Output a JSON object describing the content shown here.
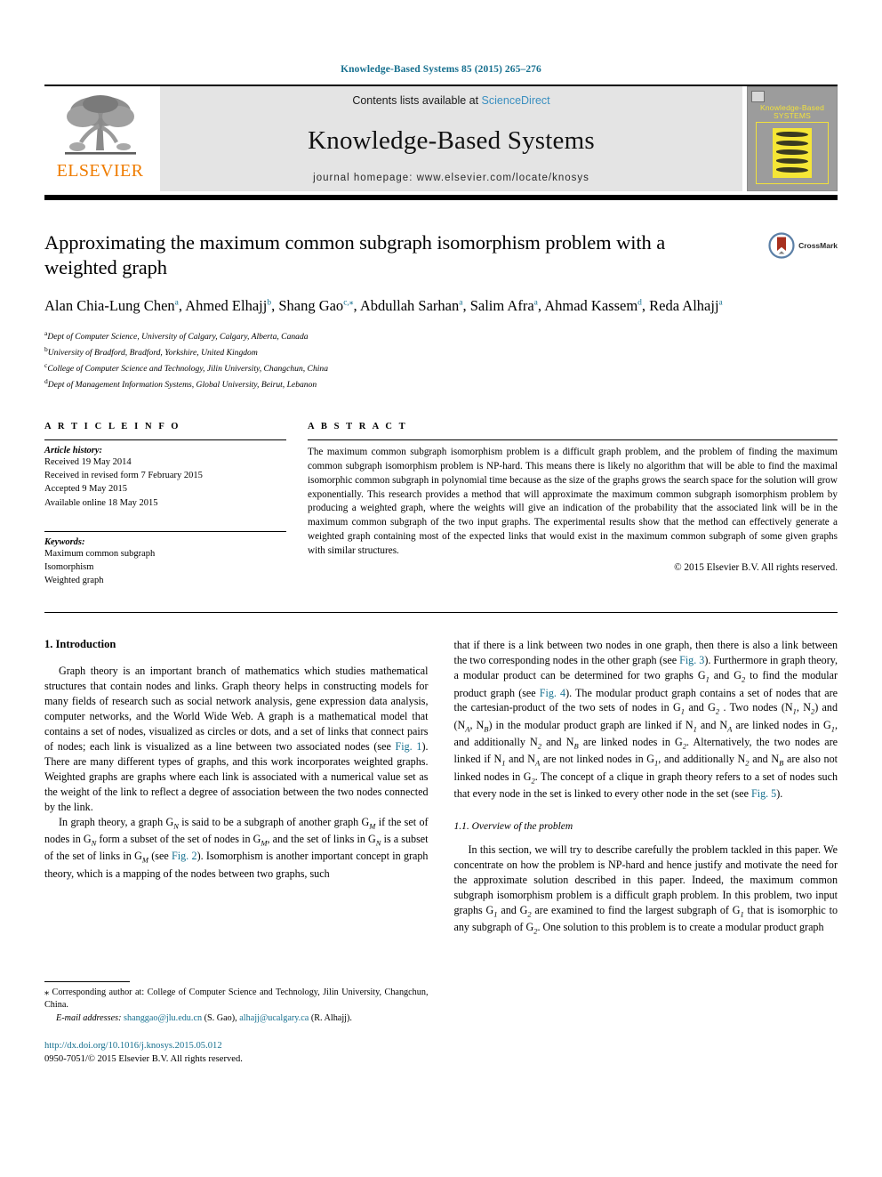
{
  "running_head": "Knowledge-Based Systems 85 (2015) 265–276",
  "masthead": {
    "publisher_name": "ELSEVIER",
    "contents_prefix": "Contents lists available at ",
    "contents_link": "ScienceDirect",
    "journal_title": "Knowledge-Based Systems",
    "homepage_line": "journal homepage: www.elsevier.com/locate/knosys",
    "cover": {
      "line1": "Knowledge-Based",
      "line2": "SYSTEMS"
    },
    "colors": {
      "elsevier_orange": "#ef7c00",
      "link_blue": "#17708f",
      "sciencedirect_blue": "#3a8fc0",
      "band_gray": "#e4e4e4",
      "cover_gray": "#9c9c9c",
      "cover_yellow": "#f2e23a"
    }
  },
  "title": "Approximating the maximum common subgraph isomorphism problem with a weighted graph",
  "crossmark_label": "CrossMark",
  "authors": [
    {
      "name": "Alan Chia-Lung Chen",
      "marks": "a",
      "sep": ", "
    },
    {
      "name": "Ahmed Elhajj",
      "marks": "b",
      "sep": ", "
    },
    {
      "name": "Shang Gao",
      "marks": "c,⁎",
      "sep": ", "
    },
    {
      "name": "Abdullah Sarhan",
      "marks": "a",
      "sep": ", "
    },
    {
      "name": "Salim Afra",
      "marks": "a",
      "sep": ", "
    },
    {
      "name": "Ahmad Kassem",
      "marks": "d",
      "sep": ", "
    },
    {
      "name": "Reda Alhajj",
      "marks": "a",
      "sep": ""
    }
  ],
  "affiliations": [
    {
      "mark": "a",
      "text": "Dept of Computer Science, University of Calgary, Calgary, Alberta, Canada"
    },
    {
      "mark": "b",
      "text": "University of Bradford, Bradford, Yorkshire, United Kingdom"
    },
    {
      "mark": "c",
      "text": "College of Computer Science and Technology, Jilin University, Changchun, China"
    },
    {
      "mark": "d",
      "text": "Dept of Management Information Systems, Global University, Beirut, Lebanon"
    }
  ],
  "article_info": {
    "heading": "A R T I C L E  I N F O",
    "history_label": "Article history:",
    "history": [
      "Received 19 May 2014",
      "Received in revised form 7 February 2015",
      "Accepted 9 May 2015",
      "Available online 18 May 2015"
    ],
    "keywords_label": "Keywords:",
    "keywords": [
      "Maximum common subgraph",
      "Isomorphism",
      "Weighted graph"
    ]
  },
  "abstract": {
    "heading": "A B S T R A C T",
    "text": "The maximum common subgraph isomorphism problem is a difficult graph problem, and the problem of finding the maximum common subgraph isomorphism problem is NP-hard. This means there is likely no algorithm that will be able to find the maximal isomorphic common subgraph in polynomial time because as the size of the graphs grows the search space for the solution will grow exponentially. This research provides a method that will approximate the maximum common subgraph isomorphism problem by producing a weighted graph, where the weights will give an indication of the probability that the associated link will be in the maximum common subgraph of the two input graphs. The experimental results show that the method can effectively generate a weighted graph containing most of the expected links that would exist in the maximum common subgraph of some given graphs with similar structures.",
    "copyright": "© 2015 Elsevier B.V. All rights reserved."
  },
  "body": {
    "section_number_title": "1. Introduction",
    "left_para_1_a": "Graph theory is an important branch of mathematics which studies mathematical structures that contain nodes and links. Graph theory helps in constructing models for many fields of research such as social network analysis, gene expression data analysis, computer networks, and the World Wide Web. A graph is a mathematical model that contains a set of nodes, visualized as circles or dots, and a set of links that connect pairs of nodes; each link is visualized as a line between two associated nodes (see ",
    "left_para_1_fig": "Fig. 1",
    "left_para_1_b": "). There are many different types of graphs, and this work incorporates weighted graphs. Weighted graphs are graphs where each link is associated with a numerical value set as the weight of the link to reflect a degree of association between the two nodes connected by the link.",
    "left_para_2_a": "In graph theory, a graph G",
    "left_para_2_b": " is said to be a subgraph of another graph G",
    "left_para_2_c": " if the set of nodes in G",
    "left_para_2_d": " form a subset of the set of nodes in G",
    "left_para_2_e": ", and the set of links in G",
    "left_para_2_f": " is a subset of the set of links in G",
    "left_para_2_g": " (see ",
    "left_para_2_fig": "Fig. 2",
    "left_para_2_h": "). Isomorphism is another important concept in graph theory, which is a mapping of the nodes between two graphs, such",
    "right_para_1_a": "that if there is a link between two nodes in one graph, then there is also a link between the two corresponding nodes in the other graph (see ",
    "right_para_1_fig3": "Fig. 3",
    "right_para_1_b": "). Furthermore in graph theory, a modular product can be determined for two graphs G",
    "right_para_1_c": " and G",
    "right_para_1_d": " to find the modular product graph (see ",
    "right_para_1_fig4": "Fig. 4",
    "right_para_1_e": "). The modular product graph contains a set of nodes that are the cartesian-product of the two sets of nodes in G",
    "right_para_1_f": " and G",
    "right_para_1_g": " . Two nodes (N",
    "right_para_1_h": ", N",
    "right_para_1_i": ") and (N",
    "right_para_1_j": ", N",
    "right_para_1_k": ") in the modular product graph are linked if N",
    "right_para_1_l": " and N",
    "right_para_1_m": " are linked nodes in G",
    "right_para_1_n": ", and additionally N",
    "right_para_1_o": " and N",
    "right_para_1_p": " are linked nodes in G",
    "right_para_1_q": ". Alternatively, the two nodes are linked if N",
    "right_para_1_r": " and N",
    "right_para_1_s": " are not linked nodes in G",
    "right_para_1_t": ", and additionally N",
    "right_para_1_u": " and N",
    "right_para_1_v": " are also not linked nodes in G",
    "right_para_1_w": ". The concept of a clique in graph theory refers to a set of nodes such that every node in the set is linked to every other node in the set (see ",
    "right_para_1_fig5": "Fig. 5",
    "right_para_1_x": ").",
    "subsection_title": "1.1. Overview of the problem",
    "right_para_2_a": "In this section, we will try to describe carefully the problem tackled in this paper. We concentrate on how the problem is NP-hard and hence justify and motivate the need for the approximate solution described in this paper. Indeed, the maximum common subgraph isomorphism problem is a difficult graph problem. In this problem, two input graphs G",
    "right_para_2_b": " and G",
    "right_para_2_c": " are examined to find the largest subgraph of G",
    "right_para_2_d": " that is isomorphic to any subgraph of G",
    "right_para_2_e": ". One solution to this problem is to create a modular product graph"
  },
  "footnote": {
    "corr_star": "⁎",
    "corr_text": " Corresponding author at: College of Computer Science and Technology, Jilin University, Changchun, China.",
    "email_label": "E-mail addresses:",
    "email_1": "shanggao@jlu.edu.cn",
    "email_1_owner": " (S. Gao), ",
    "email_2": "alhajj@ucalgary.ca",
    "email_2_owner": " (R. Alhajj)."
  },
  "doi": {
    "url": "http://dx.doi.org/10.1016/j.knosys.2015.05.012",
    "issn_line": "0950-7051/© 2015 Elsevier B.V. All rights reserved."
  },
  "subscripts": {
    "N": "N",
    "M": "M",
    "one": "1",
    "two": "2",
    "A": "A",
    "B": "B"
  }
}
